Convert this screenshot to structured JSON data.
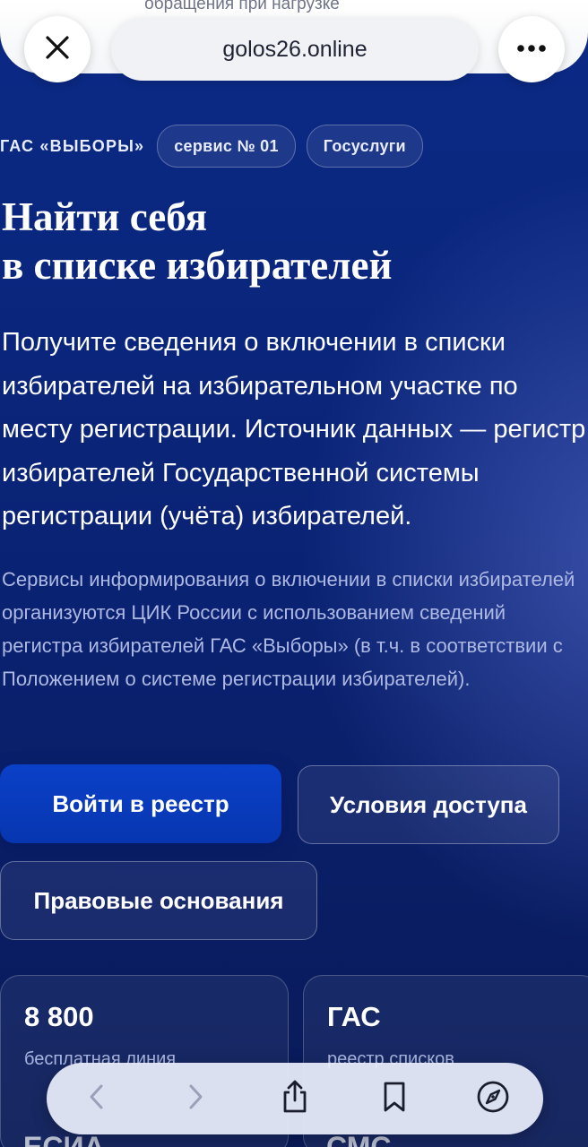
{
  "browser": {
    "scrolled_text": "обращения при нагрузке",
    "url": "golos26.online",
    "close_icon": "close-icon",
    "more_icon": "more-icon"
  },
  "tags": {
    "system": "ГАС «ВЫБОРЫ»",
    "service": "сервис № 01",
    "source": "Госуслуги"
  },
  "hero": {
    "title_line1": "Найти себя",
    "title_line2": "в списке избирателей",
    "lead": "Получите сведения о включении в списки избирателей на избирательном участке по месту регистрации. Источник данных — регистр избирателей Государственной системы регистрации (учёта) избирателей.",
    "note": "Сервисы информирования о включении в списки избирателей организуются ЦИК России с использованием сведений регистра избирателей ГАС «Выборы» (в т.ч. в соответствии с Положением о системе регистрации избирателей)."
  },
  "actions": {
    "login": "Войти в реестр",
    "access": "Условия доступа",
    "legal": "Правовые основания"
  },
  "stats": [
    {
      "value": "8 800",
      "caption": "бесплатная линия"
    },
    {
      "value": "ГАС",
      "caption": "реестр списков"
    }
  ],
  "stats_next_row": [
    "ЕСИА",
    "СМС"
  ],
  "toolbar": {
    "icons": [
      "back-icon",
      "forward-icon",
      "share-icon",
      "bookmarks-icon",
      "compass-icon"
    ]
  },
  "colors": {
    "background": "#0a2478",
    "primary_button": "#0a40c8",
    "text": "#ffffff",
    "muted_text": "#aeb9e3"
  }
}
